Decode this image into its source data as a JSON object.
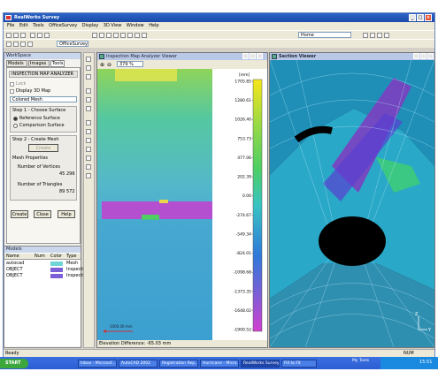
{
  "app": {
    "title": "RealWorks Survey",
    "buttons": [
      "_",
      "□",
      "×"
    ]
  },
  "menu": [
    "File",
    "Edit",
    "Tools",
    "OfficeSurvey",
    "Display",
    "3D View",
    "Window",
    "Help"
  ],
  "toolbar": {
    "mode": "OfficeSurvey",
    "home_combo": "Home"
  },
  "left_panel": {
    "header": "WorkSpace",
    "tabs": [
      "Models",
      "Images",
      "Tools"
    ],
    "section_title": "INSPECTION MAP ANALYZER",
    "lock_label": "Lock",
    "display_3d_label": "Display 3D Map",
    "mesh_combo": "Colored Mesh",
    "step1_title": "Step 1 - Choose Surface",
    "opt_reference": "Reference Surface",
    "opt_comparison": "Comparison Surface",
    "step2_title": "Step 2 - Create Mesh",
    "create_mesh_btn": "Create",
    "mesh_props_title": "Mesh Properties",
    "vertices_label": "Number of Vertices",
    "vertices_value": "45 296",
    "triangles_label": "Number of Triangles",
    "triangles_value": "89 572",
    "btn_create": "Create",
    "btn_close": "Close",
    "btn_help": "Help"
  },
  "models_panel": {
    "header": "Models",
    "columns": [
      "Name",
      "Num",
      "Color",
      "Type"
    ],
    "rows": [
      {
        "name": "autocad",
        "type": "Mesh",
        "color": "#6fd4d4"
      },
      {
        "name": "OBJECT",
        "type": "Inspectio",
        "color": "#7b5fd6"
      },
      {
        "name": "OBJECT",
        "type": "Inspectio",
        "color": "#7b5fd6"
      }
    ]
  },
  "inspection_viewer": {
    "title": "Inspection Map Analyzer Viewer",
    "zoom": "379 %",
    "scale_caption": "1000.00 mm",
    "status": "Elevation Difference: -65.03 mm"
  },
  "colorbar": {
    "unit": "[mm]",
    "ticks": [
      "1705.85",
      "1280.61",
      "1026.40",
      "753.73",
      "477.06",
      "202.39",
      "0.00",
      "-274.67",
      "-549.34",
      "-824.01",
      "-1098.68",
      "-1373.35",
      "-1648.02",
      "-1900.52"
    ],
    "colors": {
      "top": "#f6e61a",
      "green": "#4fcf62",
      "cyan": "#39c3c3",
      "blue": "#2f79d8",
      "magenta": "#d13fd0"
    }
  },
  "section_viewer": {
    "title": "Section Viewer",
    "axis_z": "Z",
    "axis_y": "Y"
  },
  "status_bar": {
    "left": "Ready",
    "right": "NUM"
  },
  "taskbar": {
    "start": "START",
    "tasks": [
      "Inbox - Microsof...",
      "AutoCAD 2002",
      "Registration Rep...",
      "Hurricane - Micro...",
      "RealWorks Survey",
      "Fill to Fit"
    ],
    "tray_label": "My Tools",
    "clock": "15:51"
  }
}
